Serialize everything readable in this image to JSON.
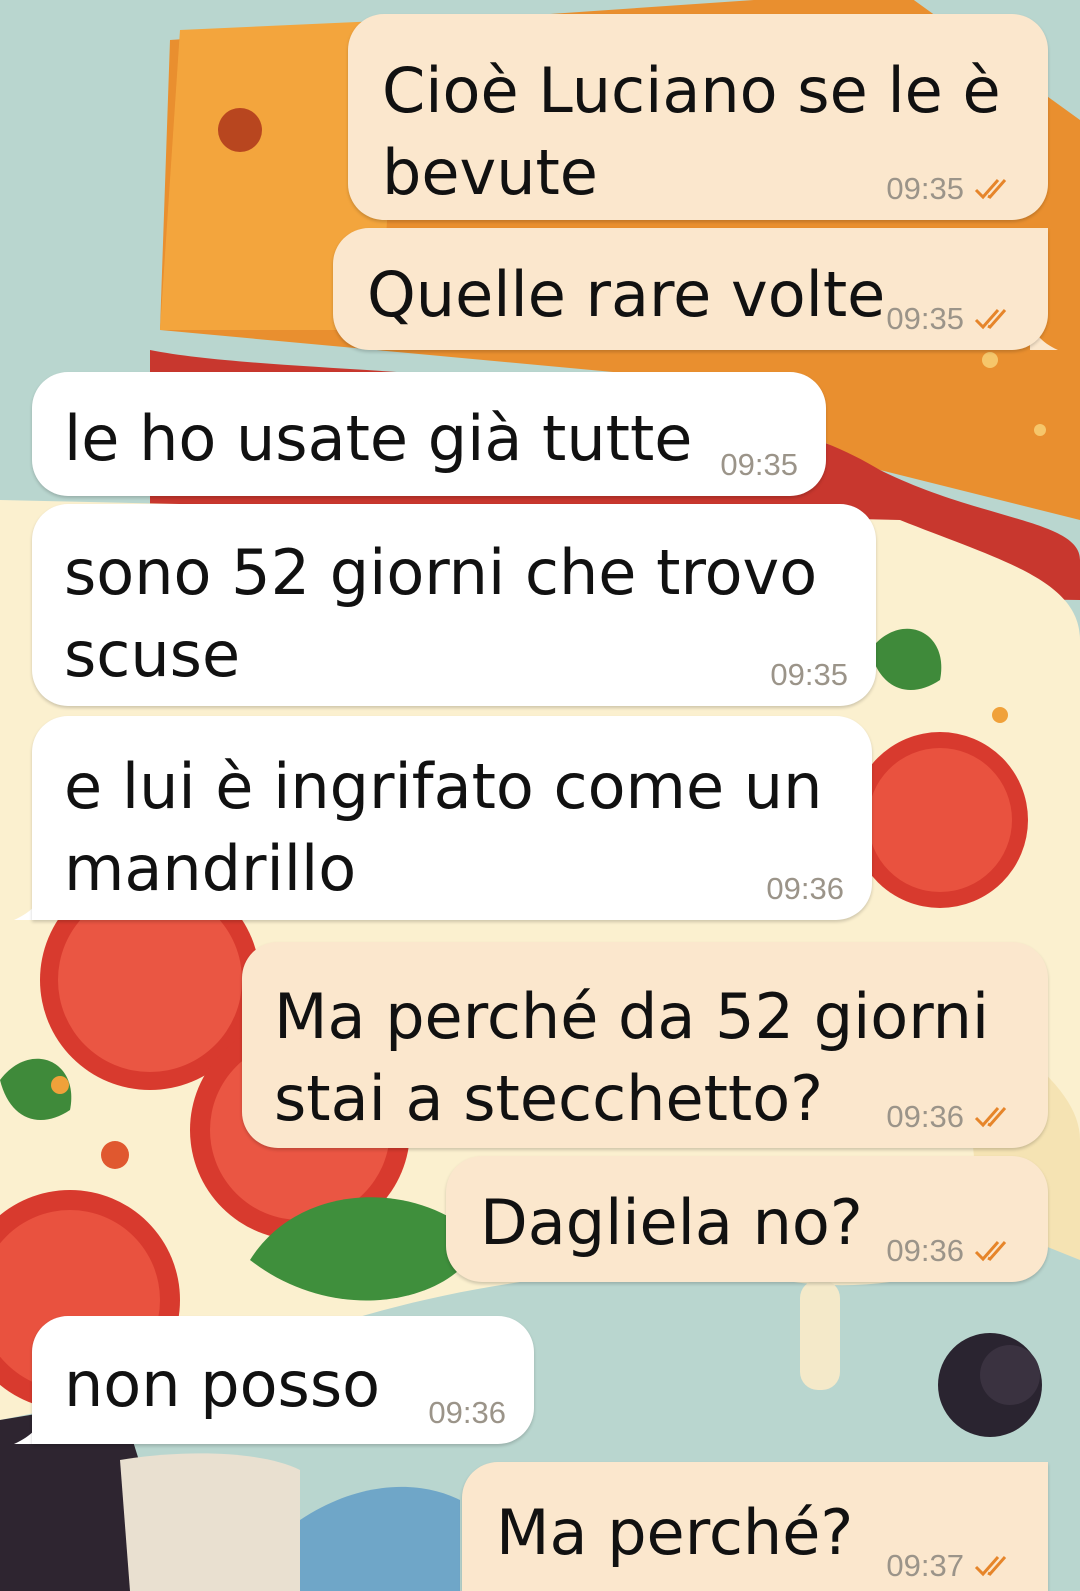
{
  "colors": {
    "outgoing_bubble": "#fbe7cd",
    "incoming_bubble": "#ffffff",
    "timestamp": "#9b9489",
    "read_ticks": "#e6852a"
  },
  "icons": {
    "read_receipt": "double-check-icon"
  },
  "messages": [
    {
      "direction": "out",
      "text": "Cioè Luciano se le è\nbevute",
      "time": "09:35",
      "read": true
    },
    {
      "direction": "out",
      "text": "Quelle rare volte",
      "time": "09:35",
      "read": true
    },
    {
      "direction": "in",
      "text": "le ho usate già tutte",
      "time": "09:35"
    },
    {
      "direction": "in",
      "text": "sono 52 giorni che trovo\nscuse",
      "time": "09:35"
    },
    {
      "direction": "in",
      "text": "e lui è ingrifato come un\nmandrillo",
      "time": "09:36"
    },
    {
      "direction": "out",
      "text": "Ma perché da 52 giorni\nstai a stecchetto?",
      "time": "09:36",
      "read": true
    },
    {
      "direction": "out",
      "text": "Dagliela no?",
      "time": "09:36",
      "read": true
    },
    {
      "direction": "in",
      "text": "non posso",
      "time": "09:36"
    },
    {
      "direction": "out",
      "text": "Ma perché?",
      "time": "09:37",
      "read": true
    }
  ]
}
